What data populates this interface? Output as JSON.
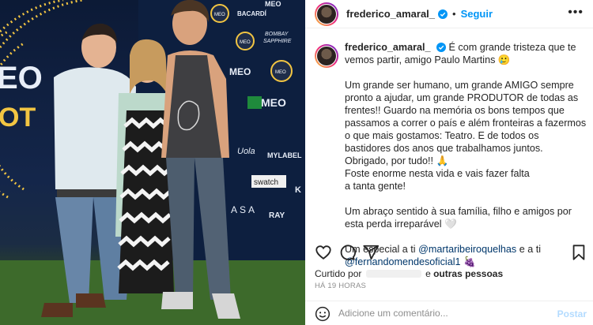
{
  "post": {
    "username": "frederico_amaral_",
    "separator": "•",
    "follow_label": "Seguir",
    "more_label": "•••"
  },
  "photo": {
    "sponsor_logos": [
      "MEO SPOT",
      "BACARDÍ",
      "BOMBAY SAPPHIRE",
      "MEO",
      "MYLABEL",
      "swatch",
      "RAY"
    ]
  },
  "caption": {
    "username": "frederico_amaral_",
    "lines": [
      "É com grande tristeza que te vemos partir, amigo Paulo Martins 🥲",
      "",
      "Um grande ser humano, um grande AMIGO sempre pronto a ajudar, um grande PRODUTOR de todas as frentes!! Guardo na memória os bons tempos que passamos a correr o país e além fronteiras a fazermos o que mais gostamos: Teatro. E de todos os bastidores dos anos que trabalhamos juntos.",
      "Obrigado, por tudo!! 🙏",
      "Foste enorme nesta vida e vais fazer falta",
      "a tanta gente!",
      "",
      "Um abraço sentido à sua família, filho e amigos por esta perda irreparável 🤍"
    ],
    "special_prefix": "Um especial a ti",
    "mention_1": "@martaribeiroquelhas",
    "conjunction": "e a ti",
    "mention_2": "@fernandomendesoficial1",
    "trailing_emoji": "🍇"
  },
  "engagement": {
    "liked_by_prefix": "Curtido por",
    "liked_by_suffix": "e",
    "others_label": "outras pessoas",
    "timestamp": "HÁ 19 HORAS"
  },
  "comment": {
    "placeholder": "Adicione um comentário...",
    "post_label": "Postar"
  },
  "colors": {
    "accent": "#0095f6",
    "verified": "#0095f6",
    "mention": "#00376b"
  }
}
